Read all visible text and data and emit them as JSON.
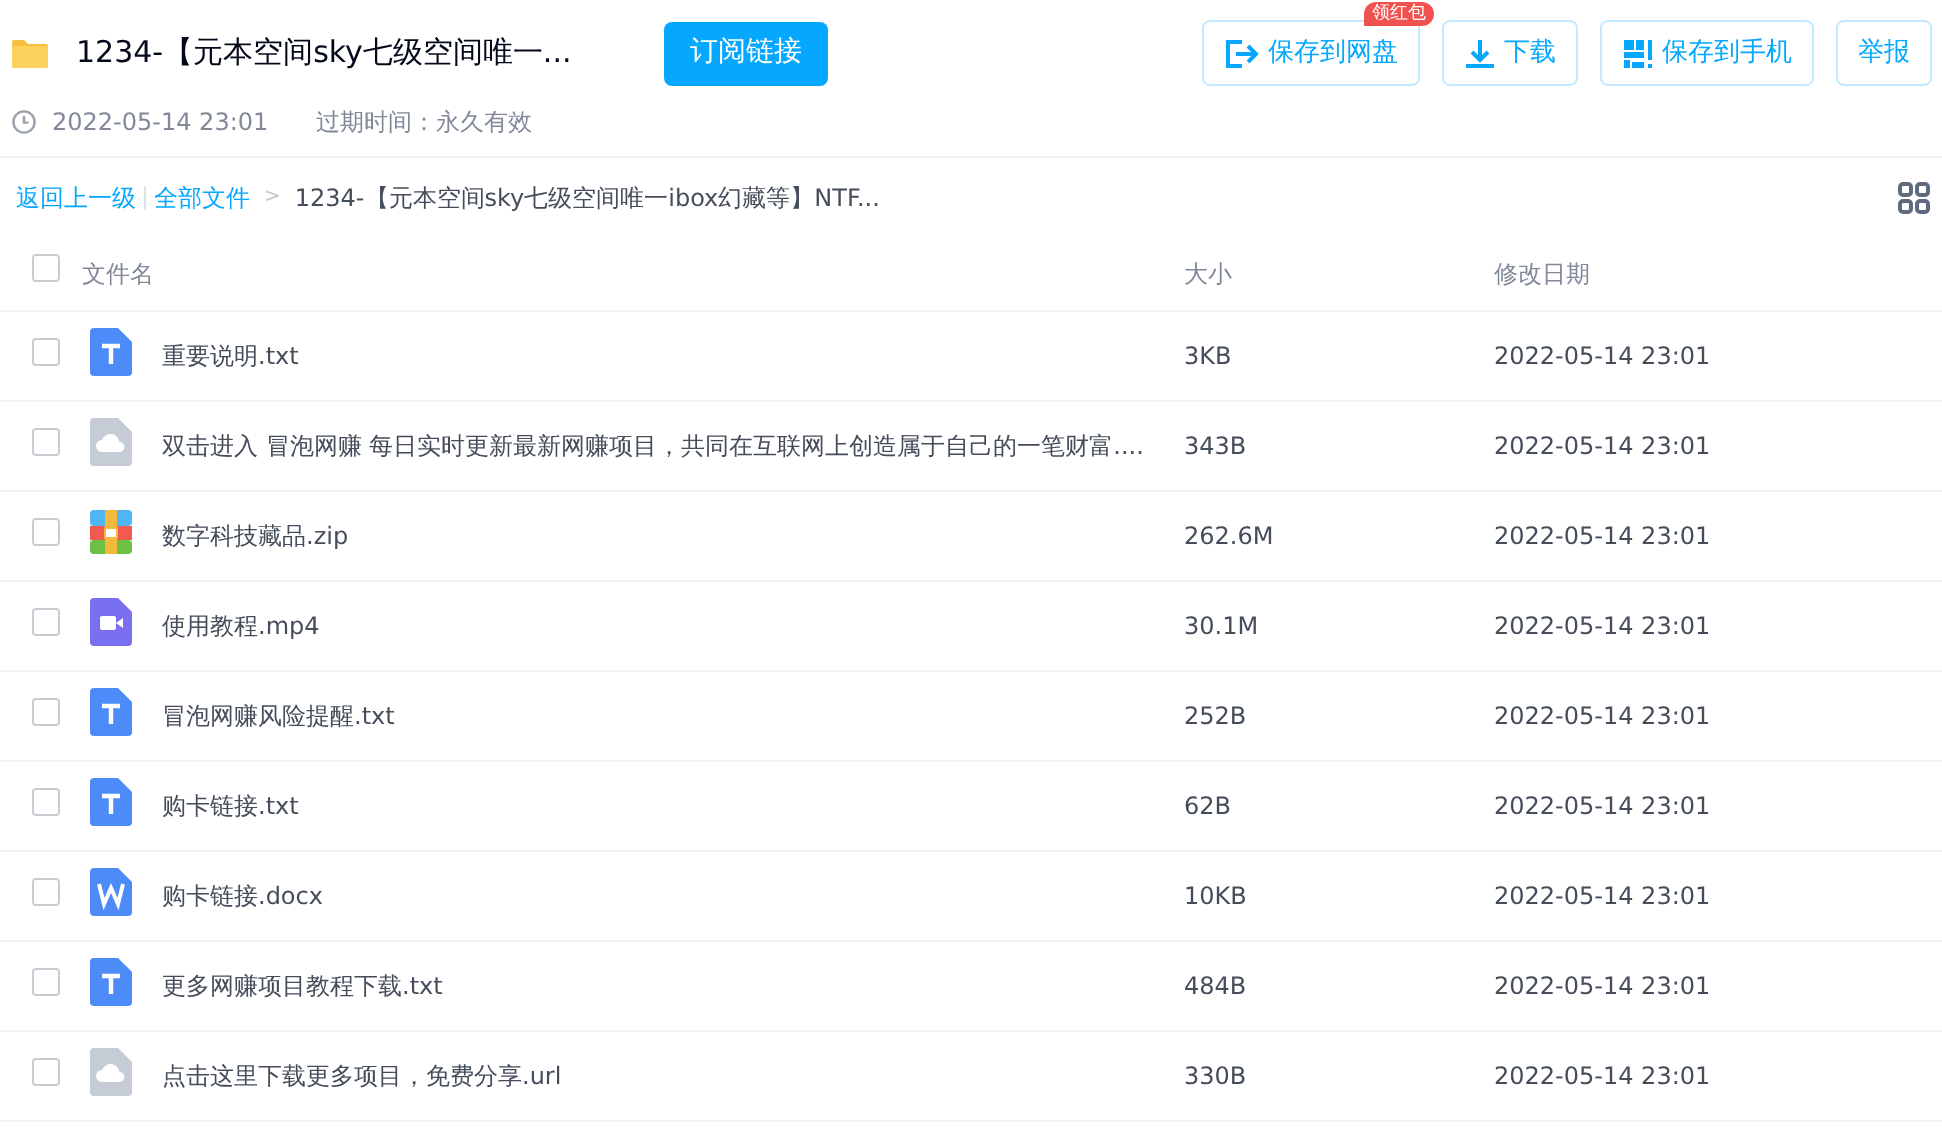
{
  "header": {
    "title": "1234-【元本空间sky七级空间唯一...",
    "subscribe_button": "订阅链接",
    "actions": [
      {
        "kind": "save",
        "label": "保存到网盘",
        "badge": "领红包"
      },
      {
        "kind": "download",
        "label": "下载"
      },
      {
        "kind": "phone",
        "label": "保存到手机"
      },
      {
        "kind": "plain",
        "label": "举报"
      }
    ]
  },
  "meta": {
    "date": "2022-05-14 23:01",
    "expiry": "过期时间：永久有效"
  },
  "breadcrumb": {
    "back": "返回上一级",
    "root": "全部文件",
    "separator": ">",
    "current": "1234-【元本空间sky七级空间唯一ibox幻藏等】NTF..."
  },
  "table": {
    "columns": [
      "文件名",
      "大小",
      "修改日期"
    ],
    "all_checked": false,
    "rows": [
      {
        "kind": "txt",
        "name": "重要说明.txt",
        "size": "3KB",
        "date": "2022-05-14 23:01",
        "checked": false
      },
      {
        "kind": "link",
        "name": "双击进入 冒泡网赚 每日实时更新最新网赚项目，共同在互联网上创造属于自己的一笔财富....",
        "size": "343B",
        "date": "2022-05-14 23:01",
        "checked": false
      },
      {
        "kind": "zip",
        "name": "数字科技藏品.zip",
        "size": "262.6M",
        "date": "2022-05-14 23:01",
        "checked": false
      },
      {
        "kind": "video",
        "name": "使用教程.mp4",
        "size": "30.1M",
        "date": "2022-05-14 23:01",
        "checked": false
      },
      {
        "kind": "txt",
        "name": "冒泡网赚风险提醒.txt",
        "size": "252B",
        "date": "2022-05-14 23:01",
        "checked": false
      },
      {
        "kind": "txt",
        "name": "购卡链接.txt",
        "size": "62B",
        "date": "2022-05-14 23:01",
        "checked": false
      },
      {
        "kind": "word",
        "name": "购卡链接.docx",
        "size": "10KB",
        "date": "2022-05-14 23:01",
        "checked": false
      },
      {
        "kind": "txt",
        "name": "更多网赚项目教程下载.txt",
        "size": "484B",
        "date": "2022-05-14 23:01",
        "checked": false
      },
      {
        "kind": "link",
        "name": "点击这里下载更多项目，免费分享.url",
        "size": "330B",
        "date": "2022-05-14 23:01",
        "checked": false
      }
    ]
  }
}
